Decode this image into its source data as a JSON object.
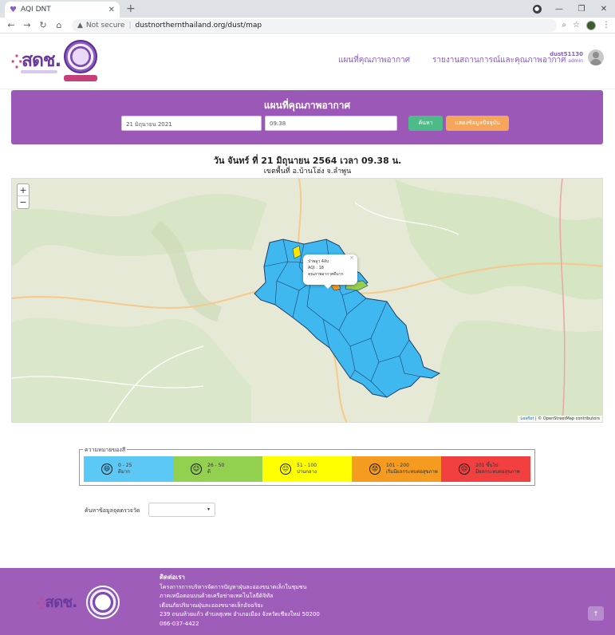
{
  "browser": {
    "tab_title": "AQI DNT",
    "new_tab": "+",
    "security": "Not secure",
    "url": "dustnorthernthailand.org/dust/map"
  },
  "header": {
    "logo_text": "สดช.",
    "nav": [
      "แผนที่คุณภาพอากาศ",
      "รายงานสถานการณ์และคุณภาพอากาศ"
    ],
    "user_name": "dust51130",
    "user_role": "admin"
  },
  "search": {
    "title": "แผนที่คุณภาพอากาศ",
    "date_value": "21 มิถุนายน 2021",
    "time_value": "09:38",
    "search_button": "ค้นหา",
    "current_button": "แสดงข้อมูลปัจจุบัน"
  },
  "headline": {
    "date_line": "วัน จันทร์ ที่ 21 มิถุนายน 2564 เวลา 09.38 น.",
    "area_line": "เขตพื้นที่ อ.บ้านโฮ่ง จ.ลำพูน"
  },
  "map": {
    "popup": [
      "ป่าพลูว 4ลับ",
      "AQI : 18",
      "คุณภาพอากาศดีมาก"
    ],
    "attribution_leaflet": "Leaflet",
    "attribution_rest": "| © OpenStreetMap contributors",
    "colors": {
      "district": "#3fb7ef",
      "yellow": "#ffe600",
      "green": "#93d04f"
    }
  },
  "legend": {
    "title": "ความหมายของสี",
    "items": [
      {
        "range": "0 - 25",
        "label": "ดีมาก",
        "face": "😄",
        "color": "#5bc8f5"
      },
      {
        "range": "26 - 50",
        "label": "ดี",
        "face": "☺",
        "color": "#93d04f"
      },
      {
        "range": "51 - 100",
        "label": "ปานกลาง",
        "face": "😐",
        "color": "#ffff00"
      },
      {
        "range": "101 - 200",
        "label": "เริ่มมีผลกระทบต่อสุขภาพ",
        "face": "😟",
        "color": "#f59b1f"
      },
      {
        "range": "201 ขึ้นไป",
        "label": "มีผลกระทบต่อสุขภาพ",
        "face": "☹",
        "color": "#f24040"
      }
    ]
  },
  "filter": {
    "label": "ค้นหาข้อมูลจุดตรวจวัด"
  },
  "footer": {
    "logo_text": "สดช.",
    "heading": "ติดต่อเรา",
    "lines": [
      "โครงการการบริหารจัดการปัญหาฝุ่นละอองขนาดเล็กในชุมชน",
      "ภาคเหนือตอนบนด้วยเครือข่ายเทคโนโลยีดิจิทัล",
      "เตือนภัยปริมาณฝุ่นละอองขนาดเล็กอัจฉริยะ",
      "239 ถนนห้วยแก้ว ตำบลสุเทพ อำเภอเมือง จังหวัดเชียงใหม่ 50200",
      "066-037-4422"
    ]
  }
}
